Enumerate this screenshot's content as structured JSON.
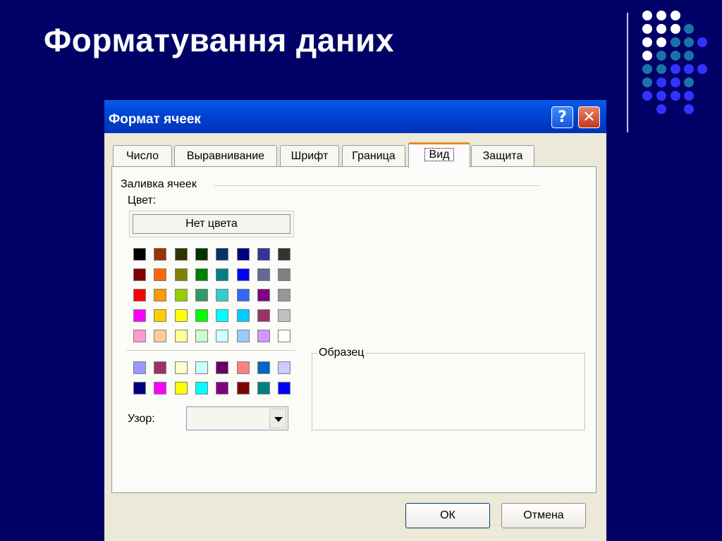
{
  "slide": {
    "title": "Форматування даних"
  },
  "dialog": {
    "title": "Формат ячеек",
    "help_label": "?",
    "close_label": "✕",
    "tabs": [
      {
        "label": "Число",
        "active": false
      },
      {
        "label": "Выравнивание",
        "active": false
      },
      {
        "label": "Шрифт",
        "active": false
      },
      {
        "label": "Граница",
        "active": false
      },
      {
        "label": "Вид",
        "active": true
      },
      {
        "label": "Защита",
        "active": false
      }
    ],
    "fill_group_label": "Заливка ячеек",
    "color_label": "Цвет:",
    "no_color_label": "Нет цвета",
    "palette_main": [
      [
        "#000000",
        "#993300",
        "#333300",
        "#003300",
        "#003366",
        "#000080",
        "#333399",
        "#333333"
      ],
      [
        "#800000",
        "#ff6600",
        "#808000",
        "#008000",
        "#008080",
        "#0000ff",
        "#666699",
        "#808080"
      ],
      [
        "#ff0000",
        "#ff9900",
        "#99cc00",
        "#339966",
        "#33cccc",
        "#3366ff",
        "#800080",
        "#969696"
      ],
      [
        "#ff00ff",
        "#ffcc00",
        "#ffff00",
        "#00ff00",
        "#00ffff",
        "#00ccff",
        "#993366",
        "#c0c0c0"
      ],
      [
        "#ff99cc",
        "#ffcc99",
        "#ffff99",
        "#ccffcc",
        "#ccffff",
        "#99ccff",
        "#cc99ff",
        "#ffffff"
      ]
    ],
    "palette_extra": [
      [
        "#9999ff",
        "#993366",
        "#ffffcc",
        "#ccffff",
        "#660066",
        "#ff8080",
        "#0066cc",
        "#ccccff"
      ],
      [
        "#000080",
        "#ff00ff",
        "#ffff00",
        "#00ffff",
        "#800080",
        "#800000",
        "#008080",
        "#0000ff"
      ]
    ],
    "pattern_label": "Узор:",
    "pattern_value": "",
    "sample_label": "Образец",
    "ok_label": "ОК",
    "cancel_label": "Отмена"
  },
  "decor": {
    "dot_colors": [
      "#ffffff",
      "#3333ff",
      "#1a73a8"
    ]
  }
}
